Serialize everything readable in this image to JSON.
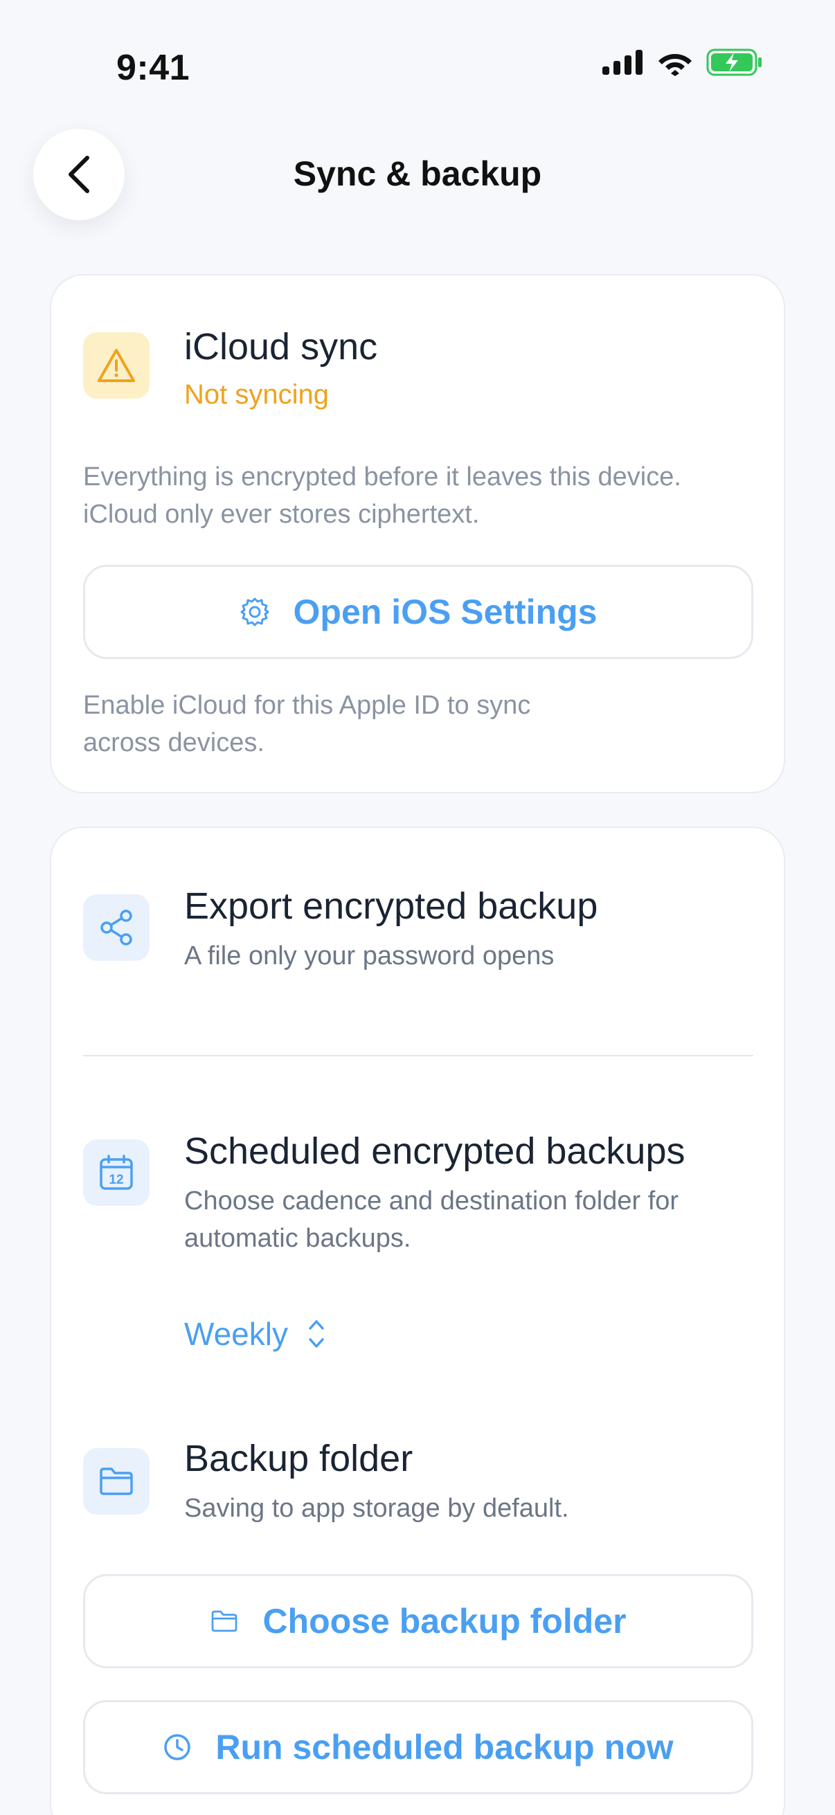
{
  "status_bar": {
    "time": "9:41"
  },
  "header": {
    "title": "Sync & backup"
  },
  "icloud": {
    "title": "iCloud sync",
    "status": "Not syncing",
    "description_line1": "Everything is encrypted before it leaves this device.",
    "description_line2": "iCloud only ever stores ciphertext.",
    "settings_button_label": "Open iOS Settings",
    "hint_line1": "Enable iCloud for this Apple ID to sync",
    "hint_line2": "across devices."
  },
  "export": {
    "title": "Export encrypted backup",
    "subtitle": "A file only your password opens"
  },
  "scheduled": {
    "title": "Scheduled encrypted backups",
    "subtitle_line1": "Choose cadence and destination folder for",
    "subtitle_line2": "automatic backups.",
    "cadence_value": "Weekly",
    "calendar_day": "12"
  },
  "folder": {
    "title": "Backup folder",
    "subtitle": "Saving to app storage by default.",
    "choose_button_label": "Choose backup folder",
    "run_button_label": "Run scheduled backup now"
  },
  "colors": {
    "accent": "#4a9ff2",
    "warning": "#f0a21d",
    "battery": "#34c759"
  }
}
